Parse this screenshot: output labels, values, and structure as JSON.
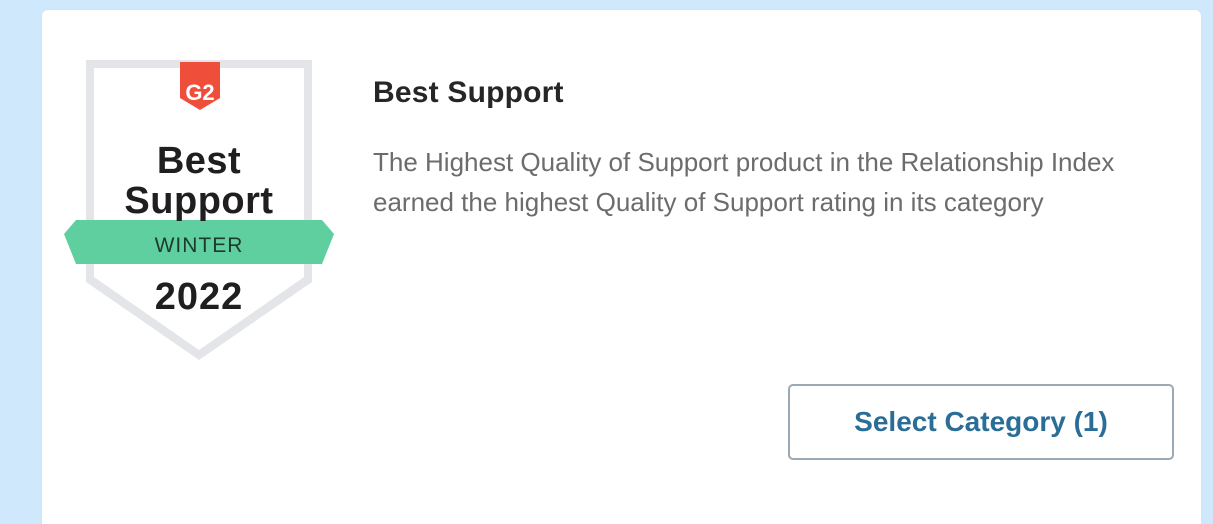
{
  "badge": {
    "logo": "G2",
    "line1": "Best",
    "line2": "Support",
    "season": "WINTER",
    "year": "2022",
    "colors": {
      "logo_red": "#ef4e3a",
      "ribbon_green": "#5fcf9f",
      "shield_border": "#e3e5e8",
      "shield_fill": "#ffffff"
    }
  },
  "award": {
    "title": "Best Support",
    "description": "The Highest Quality of Support product in the Relationship Index earned the highest Quality of Support rating in its category"
  },
  "actions": {
    "select_category_label": "Select Category (1)"
  },
  "colors": {
    "page_background": "#cfe8fb",
    "card_background": "#ffffff",
    "button_text": "#2a6d96",
    "button_border": "#9aa9b3"
  }
}
